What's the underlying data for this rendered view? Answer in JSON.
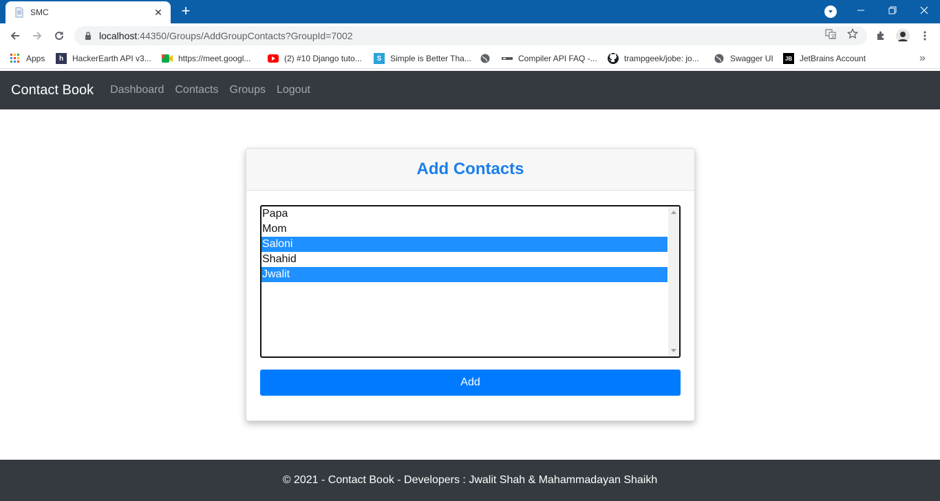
{
  "browser": {
    "tab_title": "SMC",
    "tab_close": "✕",
    "new_tab": "+",
    "url_host": "localhost",
    "url_path": ":44350/Groups/AddGroupContacts?GroupId=7002",
    "accent_color": "#0b5fa8"
  },
  "bookmarks": {
    "items": [
      {
        "label": "Apps",
        "icon": "apps-grid-icon"
      },
      {
        "label": "HackerEarth API v3...",
        "icon": "hackerearth-icon"
      },
      {
        "label": "https://meet.googl...",
        "icon": "google-meet-icon"
      },
      {
        "label": "(2) #10 Django tuto...",
        "icon": "youtube-icon"
      },
      {
        "label": "Simple is Better Tha...",
        "icon": "simple-s-icon"
      },
      {
        "label": "",
        "icon": "globe-icon"
      },
      {
        "label": "Compiler API FAQ -...",
        "icon": "compiler-icon"
      },
      {
        "label": "trampgeek/jobe: jo...",
        "icon": "github-icon"
      },
      {
        "label": "Swagger UI",
        "icon": "globe-icon"
      },
      {
        "label": "JetBrains Account",
        "icon": "jetbrains-icon"
      }
    ],
    "overflow": "»"
  },
  "site_nav": {
    "brand": "Contact Book",
    "links": [
      "Dashboard",
      "Contacts",
      "Groups",
      "Logout"
    ]
  },
  "card": {
    "title": "Add Contacts",
    "options": [
      {
        "label": "Papa",
        "selected": false
      },
      {
        "label": "Mom",
        "selected": false
      },
      {
        "label": "Saloni",
        "selected": true
      },
      {
        "label": "Shahid",
        "selected": false
      },
      {
        "label": "Jwalit",
        "selected": true
      }
    ],
    "button_label": "Add",
    "title_color": "#1a7fe8",
    "button_color": "#007bff",
    "selection_color": "#1e90ff"
  },
  "footer": {
    "text": "© 2021 - Contact Book - Developers : Jwalit Shah & Mahammadayan Shaikh"
  }
}
